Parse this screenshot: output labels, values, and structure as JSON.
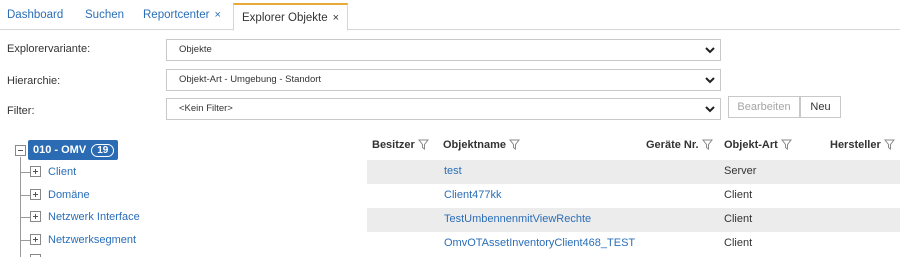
{
  "tabs": [
    {
      "label": "Dashboard",
      "closable": false,
      "active": false
    },
    {
      "label": "Suchen",
      "closable": false,
      "active": false
    },
    {
      "label": "Reportcenter",
      "closable": true,
      "active": false
    },
    {
      "label": "Explorer Objekte",
      "closable": true,
      "active": true
    }
  ],
  "tab_close_glyph": "×",
  "form": {
    "explorervariante": {
      "label": "Explorervariante:",
      "value": "Objekte"
    },
    "hierarchie": {
      "label": "Hierarchie:",
      "value": "Objekt-Art - Umgebung - Standort"
    },
    "filter": {
      "label": "Filter:",
      "value": "<Kein Filter>"
    },
    "buttons": {
      "bearbeiten": "Bearbeiten",
      "neu": "Neu"
    }
  },
  "tree": {
    "root": {
      "label": "010 - OMV",
      "count": "19"
    },
    "children": [
      "Client",
      "Domäne",
      "Netzwerk Interface",
      "Netzwerksegment"
    ]
  },
  "grid": {
    "columns": [
      "Besitzer",
      "Objektname",
      "Geräte Nr.",
      "Objekt-Art",
      "Hersteller"
    ],
    "rows": [
      {
        "objektname": "test",
        "objekt_art": "Server"
      },
      {
        "objektname": "Client477kk",
        "objekt_art": "Client"
      },
      {
        "objektname": "TestUmbennenmitViewRechte",
        "objekt_art": "Client"
      },
      {
        "objektname": "OmvOTAssetInventoryClient468_TEST",
        "objekt_art": "Client"
      }
    ]
  },
  "colors": {
    "link": "#2a6eb8",
    "active_tab_accent": "#e9a93a",
    "root_node_bg": "#2b6bb3",
    "row_shade": "#ececec"
  },
  "icons": {
    "dropdown": "chevron-down-icon",
    "column_filter": "funnel-icon",
    "tree_expand": "plus-box-icon",
    "tree_collapse": "minus-box-icon"
  }
}
